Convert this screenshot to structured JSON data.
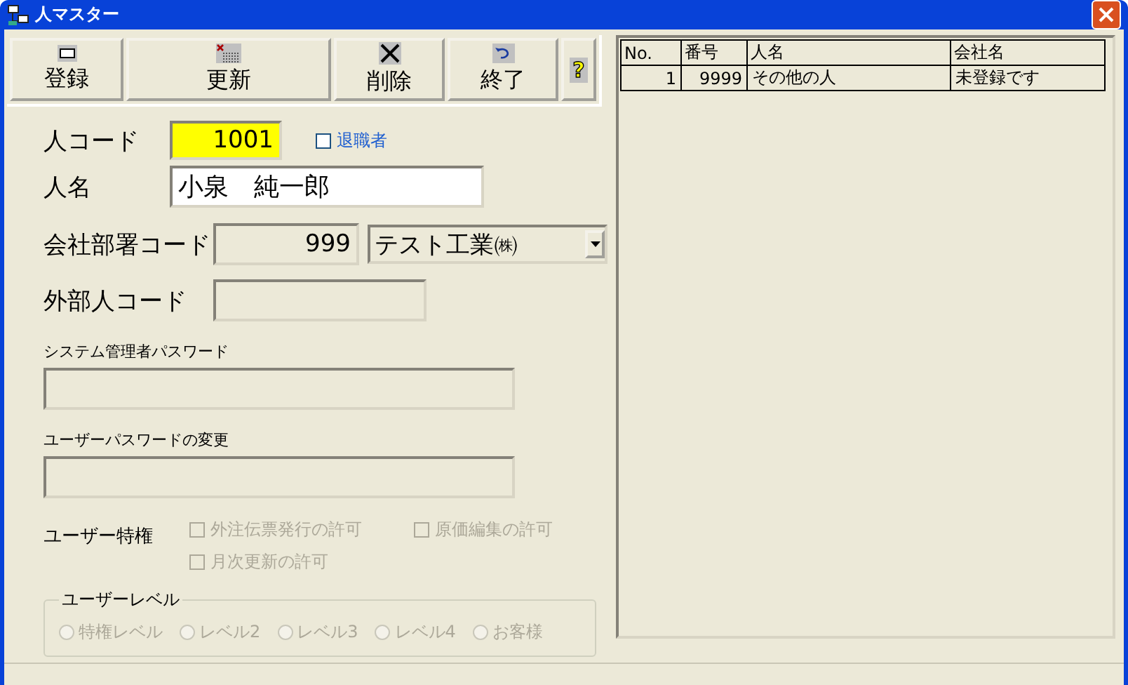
{
  "window": {
    "title": "人マスター"
  },
  "toolbar": [
    {
      "label": "登録",
      "kind": "register"
    },
    {
      "label": "更新",
      "kind": "update"
    },
    {
      "label": "削除",
      "kind": "delete"
    },
    {
      "label": "終了",
      "kind": "exit"
    },
    {
      "label": "?",
      "kind": "help"
    }
  ],
  "form": {
    "person_code": {
      "label": "人コード",
      "value": "1001"
    },
    "retired": {
      "label": "退職者",
      "checked": false
    },
    "person_name": {
      "label": "人名",
      "value": "小泉　純一郎"
    },
    "company": {
      "label": "会社部署コード",
      "code": "999",
      "name": "テスト工業㈱"
    },
    "external_code": {
      "label": "外部人コード"
    },
    "admin_password": {
      "label": "システム管理者パスワード"
    },
    "user_password": {
      "label": "ユーザーパスワードの変更"
    },
    "privileges": {
      "label": "ユーザー特権",
      "items": [
        {
          "label": "外注伝票発行の許可",
          "checked": false,
          "disabled": true
        },
        {
          "label": "原価編集の許可",
          "checked": false,
          "disabled": true
        },
        {
          "label": "月次更新の許可",
          "checked": false,
          "disabled": true
        }
      ]
    },
    "user_level": {
      "label": "ユーザーレベル",
      "options": [
        {
          "label": "特権レベル",
          "selected": false,
          "disabled": true
        },
        {
          "label": "レベル2",
          "selected": false,
          "disabled": true
        },
        {
          "label": "レベル3",
          "selected": false,
          "disabled": true
        },
        {
          "label": "レベル4",
          "selected": false,
          "disabled": true
        },
        {
          "label": "お客様",
          "selected": false,
          "disabled": true
        }
      ]
    }
  },
  "table": {
    "columns": [
      "No.",
      "番号",
      "人名",
      "会社名"
    ],
    "rows": [
      [
        "1",
        "9999",
        "その他の人",
        "未登録です"
      ]
    ]
  }
}
